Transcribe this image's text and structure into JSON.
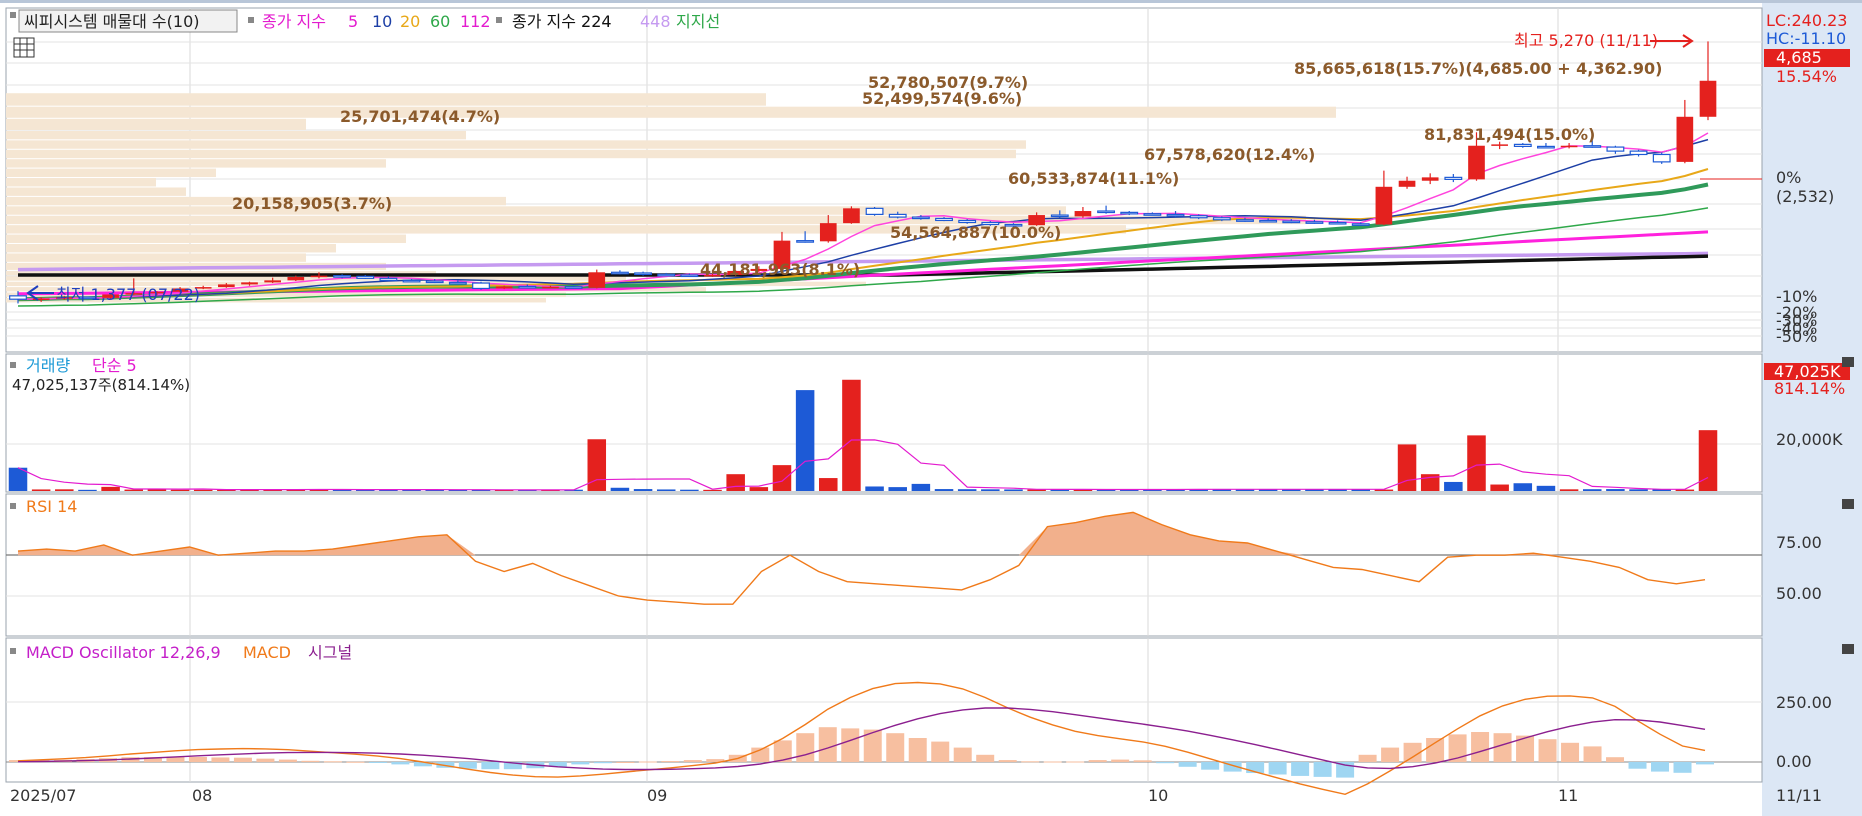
{
  "price_panel": {
    "legend": {
      "vol_profile": "씨피시스템 매물대 수(10)",
      "ma_label": "종가 지수",
      "ma_periods": [
        "5",
        "10",
        "20",
        "60",
        "112"
      ],
      "ma_long_label": "종가 지수 224",
      "ma_448": "448",
      "support": "지지선"
    },
    "right_labels": {
      "lc": "LC:240.23",
      "hc": "HC:-11.10",
      "price": "4,685",
      "pct": "15.54%"
    },
    "axis_labels": {
      "zero_pct": "0%",
      "zero_val": "(2,532)",
      "m10": "-10%",
      "m20": "-20%",
      "m30": "-30%",
      "m40": "-40%",
      "m50": "-50%"
    },
    "annotations": {
      "high": "최고 5,270 (11/11)",
      "low": "최저 1,377 (07/22)",
      "current": "85,665,618(15.7%)(4,685.00 + 4,362.90)"
    },
    "volume_profile": [
      "25,701,474(4.7%)",
      "20,158,905(3.7%)",
      "52,780,507(9.7%)",
      "52,499,574(9.6%)",
      "44,181,963(8.1%)",
      "54,564,887(10.0%)",
      "60,533,874(11.1%)",
      "67,578,620(12.4%)",
      "81,831,494(15.0%)"
    ]
  },
  "volume_panel": {
    "legend": {
      "title": "거래량",
      "ma": "단순 5"
    },
    "info": "47,025,137주(814.14%)",
    "right_labels": {
      "value": "47,025K",
      "pct": "814.14%",
      "tick": "20,000K"
    }
  },
  "rsi_panel": {
    "legend": "RSI 14",
    "ticks": [
      "75.00",
      "50.00"
    ]
  },
  "macd_panel": {
    "legend": {
      "osc": "MACD Oscillator 12,26,9",
      "macd": "MACD",
      "signal": "시그널"
    },
    "ticks": [
      "250.00",
      "0.00"
    ]
  },
  "x_axis": {
    "labels": [
      "2025/07",
      "08",
      "09",
      "10",
      "11"
    ],
    "right": "11/11"
  },
  "chart_data": {
    "type": "candlestick",
    "candles": [
      [
        1490,
        1560,
        1377,
        1440
      ],
      [
        1440,
        1470,
        1400,
        1450
      ],
      [
        1450,
        1490,
        1430,
        1470
      ],
      [
        1470,
        1480,
        1450,
        1460
      ],
      [
        1460,
        1530,
        1440,
        1510
      ],
      [
        1510,
        1750,
        1500,
        1530
      ],
      [
        1530,
        1560,
        1500,
        1550
      ],
      [
        1550,
        1620,
        1540,
        1600
      ],
      [
        1600,
        1640,
        1590,
        1620
      ],
      [
        1620,
        1680,
        1610,
        1660
      ],
      [
        1660,
        1700,
        1640,
        1690
      ],
      [
        1690,
        1760,
        1680,
        1720
      ],
      [
        1720,
        1790,
        1710,
        1770
      ],
      [
        1770,
        1840,
        1750,
        1790
      ],
      [
        1790,
        1810,
        1750,
        1780
      ],
      [
        1780,
        1800,
        1740,
        1750
      ],
      [
        1750,
        1780,
        1710,
        1720
      ],
      [
        1720,
        1740,
        1700,
        1710
      ],
      [
        1710,
        1740,
        1680,
        1690
      ],
      [
        1690,
        1720,
        1670,
        1680
      ],
      [
        1680,
        1700,
        1580,
        1600
      ],
      [
        1600,
        1640,
        1590,
        1630
      ],
      [
        1630,
        1660,
        1600,
        1620
      ],
      [
        1620,
        1640,
        1610,
        1625
      ],
      [
        1625,
        1640,
        1600,
        1610
      ],
      [
        1610,
        1880,
        1600,
        1840
      ],
      [
        1840,
        1870,
        1810,
        1830
      ],
      [
        1830,
        1850,
        1790,
        1810
      ],
      [
        1810,
        1830,
        1790,
        1800
      ],
      [
        1800,
        1820,
        1780,
        1790
      ],
      [
        1790,
        1820,
        1770,
        1800
      ],
      [
        1800,
        1870,
        1790,
        1860
      ],
      [
        1860,
        1930,
        1840,
        1890
      ],
      [
        1890,
        2440,
        1880,
        2310
      ],
      [
        2310,
        2450,
        2280,
        2300
      ],
      [
        2300,
        2690,
        2280,
        2570
      ],
      [
        2570,
        2820,
        2560,
        2790
      ],
      [
        2790,
        2810,
        2680,
        2700
      ],
      [
        2700,
        2740,
        2640,
        2660
      ],
      [
        2660,
        2690,
        2620,
        2640
      ],
      [
        2640,
        2660,
        2600,
        2610
      ],
      [
        2610,
        2630,
        2560,
        2580
      ],
      [
        2580,
        2600,
        2530,
        2550
      ],
      [
        2550,
        2570,
        2500,
        2540
      ],
      [
        2540,
        2730,
        2530,
        2690
      ],
      [
        2690,
        2760,
        2650,
        2670
      ],
      [
        2670,
        2810,
        2650,
        2750
      ],
      [
        2750,
        2830,
        2710,
        2730
      ],
      [
        2730,
        2750,
        2690,
        2710
      ],
      [
        2710,
        2730,
        2690,
        2700
      ],
      [
        2700,
        2750,
        2660,
        2680
      ],
      [
        2680,
        2700,
        2630,
        2650
      ],
      [
        2650,
        2670,
        2600,
        2620
      ],
      [
        2620,
        2650,
        2590,
        2610
      ],
      [
        2610,
        2640,
        2580,
        2600
      ],
      [
        2600,
        2630,
        2570,
        2590
      ],
      [
        2590,
        2620,
        2560,
        2580
      ],
      [
        2580,
        2610,
        2550,
        2560
      ],
      [
        2560,
        2580,
        2540,
        2550
      ],
      [
        2550,
        3350,
        2540,
        3110
      ],
      [
        3110,
        3260,
        3080,
        3200
      ],
      [
        3200,
        3310,
        3150,
        3250
      ],
      [
        3250,
        3300,
        3180,
        3220
      ],
      [
        3220,
        3920,
        3200,
        3720
      ],
      [
        3720,
        3780,
        3670,
        3740
      ],
      [
        3740,
        3760,
        3690,
        3710
      ],
      [
        3710,
        3760,
        3680,
        3700
      ],
      [
        3700,
        3760,
        3680,
        3720
      ],
      [
        3720,
        3800,
        3690,
        3700
      ],
      [
        3700,
        3720,
        3600,
        3640
      ],
      [
        3640,
        3660,
        3560,
        3590
      ],
      [
        3590,
        3620,
        3450,
        3480
      ],
      [
        3480,
        4400,
        3460,
        4150
      ],
      [
        4150,
        5270,
        4100,
        4685
      ]
    ],
    "volume": [
      18000,
      1200,
      1300,
      900,
      3200,
      1100,
      1300,
      1000,
      950,
      1100,
      1200,
      1150,
      1000,
      1300,
      1100,
      1050,
      1000,
      1100,
      1000,
      900,
      850,
      800,
      850,
      900,
      1000,
      40000,
      2500,
      1500,
      1200,
      1000,
      900,
      13000,
      3000,
      20000,
      78000,
      10000,
      86000,
      3500,
      3000,
      5500,
      1500,
      1400,
      1300,
      1200,
      1100,
      1300,
      1200,
      1000,
      1100,
      1200,
      1300,
      1400,
      1500,
      1100,
      1200,
      1300,
      1400,
      1400,
      1200,
      1100,
      36000,
      13000,
      7000,
      43000,
      5000,
      6000,
      4000,
      1300,
      1400,
      1500,
      1300,
      1200,
      1100,
      47025
    ],
    "rsi": [
      72,
      73,
      72,
      75,
      70,
      72,
      74,
      70,
      71,
      72,
      72,
      73,
      75,
      77,
      79,
      80,
      67,
      62,
      66,
      60,
      55,
      50,
      48,
      47,
      46,
      46,
      62,
      70,
      62,
      57,
      56,
      55,
      54,
      53,
      58,
      65,
      84,
      86,
      89,
      91,
      85,
      80,
      77,
      76,
      72,
      68,
      64,
      63,
      60,
      57,
      69,
      70,
      70,
      71,
      69,
      67,
      64,
      58,
      56,
      58
    ],
    "macd_osc": [
      8,
      8,
      9,
      12,
      16,
      20,
      20,
      22,
      21,
      19,
      18,
      14,
      10,
      5,
      3,
      1,
      -3,
      -10,
      -18,
      -24,
      -28,
      -30,
      -30,
      -26,
      -20,
      -10,
      -5,
      0,
      2,
      4,
      8,
      12,
      30,
      60,
      90,
      120,
      145,
      140,
      135,
      120,
      100,
      85,
      60,
      30,
      8,
      3,
      2,
      2,
      8,
      10,
      7,
      -5,
      -20,
      -32,
      -40,
      -46,
      -52,
      -58,
      -62,
      -65,
      30,
      60,
      80,
      100,
      115,
      125,
      120,
      110,
      95,
      80,
      65,
      20,
      -28,
      -40,
      -45,
      -10
    ]
  }
}
